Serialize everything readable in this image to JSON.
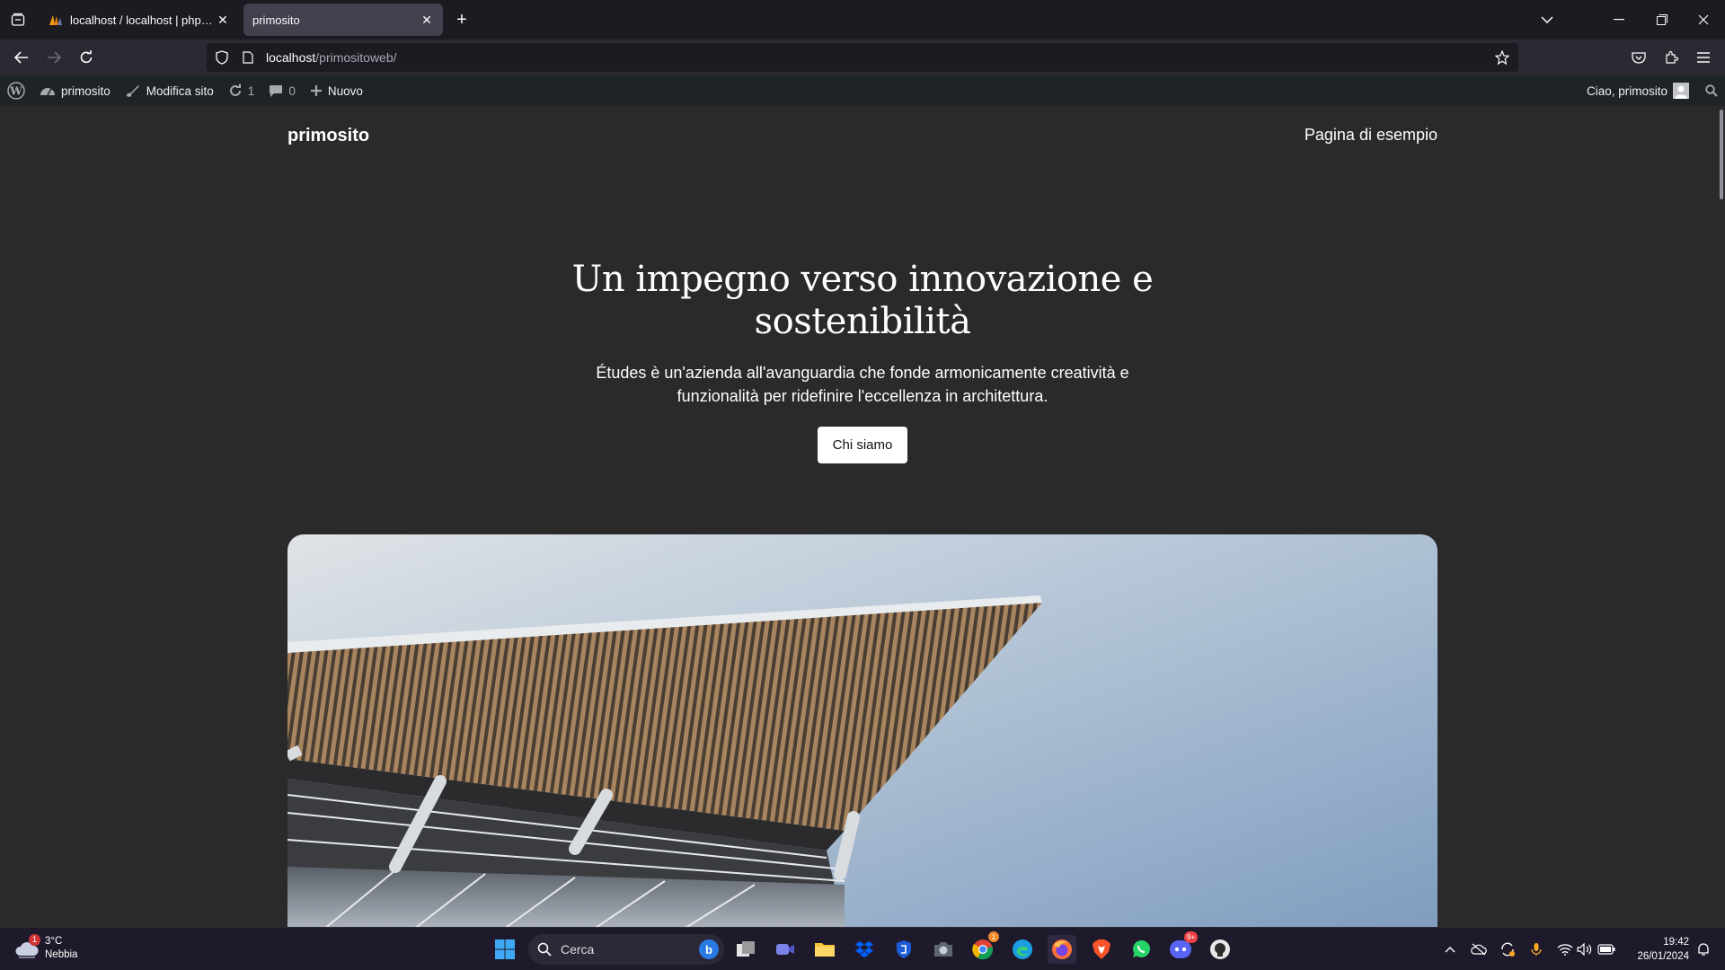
{
  "browser": {
    "tabs": [
      {
        "title": "localhost / localhost | phpMyAdmin",
        "active": false,
        "icon": "phpmyadmin-icon"
      },
      {
        "title": "primosito",
        "active": true,
        "icon": ""
      }
    ],
    "url": {
      "host": "localhost",
      "path": "/primositoweb/"
    }
  },
  "wp_admin_bar": {
    "site": "primosito",
    "customize": "Modifica sito",
    "updates": "1",
    "comments": "0",
    "new": "Nuovo",
    "greeting": "Ciao, primosito"
  },
  "site": {
    "title": "primosito",
    "nav_link": "Pagina di esempio",
    "hero": {
      "title": "Un impegno verso innovazione e sostenibilità",
      "text": "Études è un'azienda all'avanguardia che fonde armonicamente creatività e funzionalità per ridefinire l'eccellenza in architettura.",
      "button": "Chi siamo"
    }
  },
  "taskbar": {
    "weather": {
      "temp": "3°C",
      "condition": "Nebbia",
      "badge": "1"
    },
    "search_placeholder": "Cerca",
    "clock": {
      "time": "19:42",
      "date": "26/01/2024"
    },
    "badges": {
      "chrome": "1",
      "discord": "9+"
    }
  },
  "colors": {
    "page_bg": "#2a2a2a",
    "admin_bar": "#1d2327",
    "browser_bg": "#1c1b22"
  }
}
